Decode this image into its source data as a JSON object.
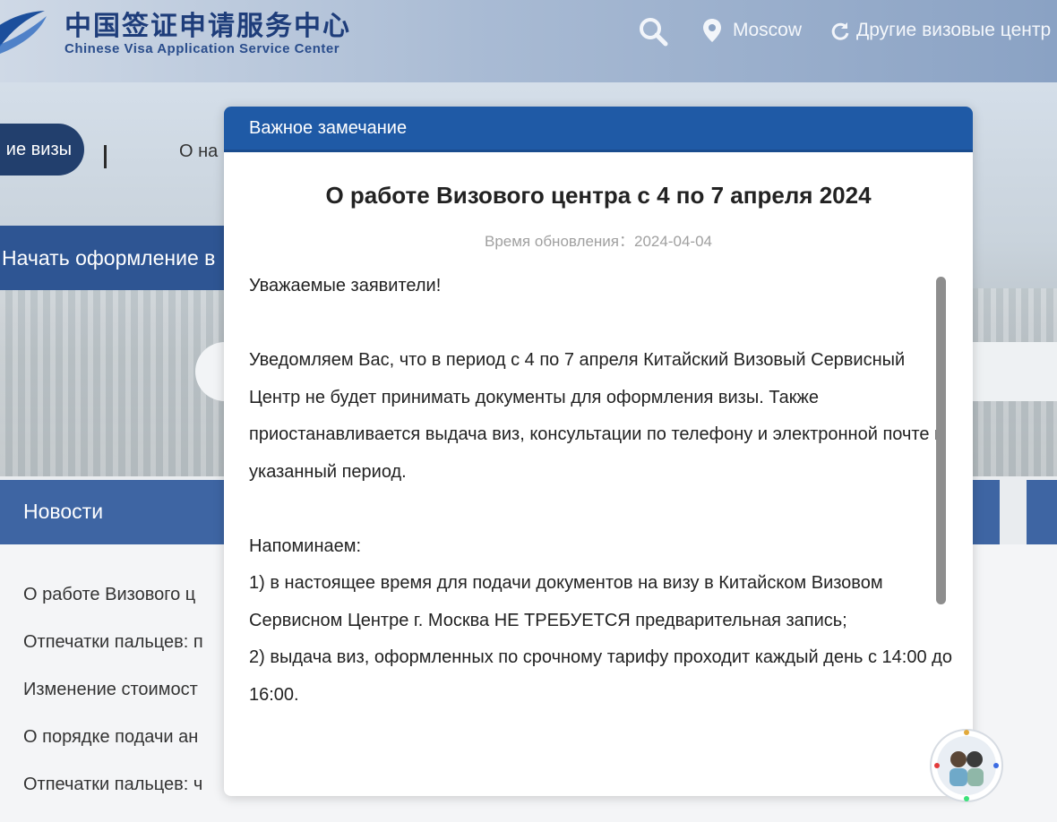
{
  "header": {
    "logo_cn": "中国签证申请服务中心",
    "logo_en": "Chinese Visa Application Service Center",
    "search_icon": "search-icon",
    "location_icon": "map-pin-icon",
    "city": "Moscow",
    "refresh_icon": "refresh-icon",
    "other_centers_label": "Другие визовые центр"
  },
  "background_nav": {
    "visa_pill_label": "ие визы",
    "divider": "|",
    "about_label": "О на",
    "start_banner_label": "Начать оформление в"
  },
  "news": {
    "title": "Новости",
    "items": [
      "О работе Визового ц",
      "Отпечатки пальцев: п",
      "Изменение стоимост",
      "О порядке подачи ан",
      "Отпечатки пальцев: ч"
    ]
  },
  "modal": {
    "header_title": "Важное замечание",
    "notice_title": "О работе Визового центра с 4 по 7 апреля 2024",
    "update_label": "Время обновления：",
    "update_date": "2024-04-04",
    "greeting": "Уважаемые заявители!",
    "paragraph1": "Уведомляем Вас, что в период с 4 по 7 апреля Китайский Визовый Сервисный Центр не будет принимать документы для оформления визы. Также приостанавливается выдача виз, консультации по телефону и электронной почте в указанный период.",
    "reminder_label": "Напоминаем:",
    "point1": "1) в настоящее время для подачи документов на визу в Китайском Визовом Сервисном Центре г. Москва НЕ ТРЕБУЕТСЯ предварительная запись;",
    "point2": "2) выдача виз, оформленных по срочному тарифу проходит каждый день с 14:00 до 16:00."
  },
  "colors": {
    "modal_header": "#1f5aa6",
    "news_bar": "#3e65a3",
    "visa_pill": "#223f6d",
    "start_banner": "#2e5593"
  }
}
